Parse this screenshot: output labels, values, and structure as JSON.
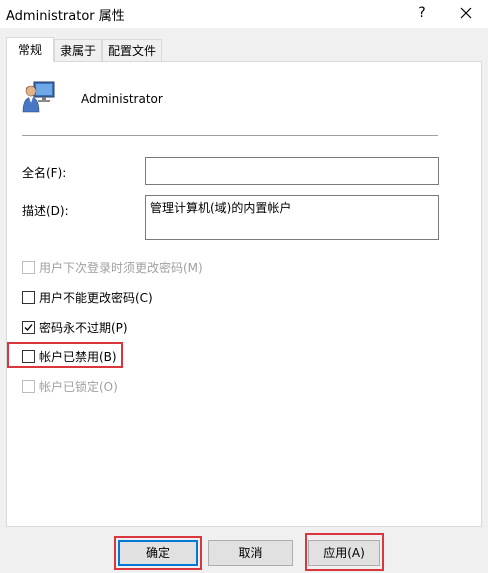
{
  "window": {
    "title": "Administrator 属性",
    "help_label": "?"
  },
  "tabs": [
    {
      "label": "常规",
      "active": true
    },
    {
      "label": "隶属于",
      "active": false
    },
    {
      "label": "配置文件",
      "active": false
    }
  ],
  "general": {
    "user_name": "Administrator",
    "full_name": {
      "label": "全名(F):",
      "value": ""
    },
    "description": {
      "label": "描述(D):",
      "value": "管理计算机(域)的内置帐户"
    },
    "options": [
      {
        "label": "用户下次登录时须更改密码(M)",
        "checked": false,
        "enabled": false
      },
      {
        "label": "用户不能更改密码(C)",
        "checked": false,
        "enabled": true
      },
      {
        "label": "密码永不过期(P)",
        "checked": true,
        "enabled": true
      },
      {
        "label": "帐户已禁用(B)",
        "checked": false,
        "enabled": true
      },
      {
        "label": "帐户已锁定(O)",
        "checked": false,
        "enabled": false
      }
    ]
  },
  "buttons": {
    "ok": "确定",
    "cancel": "取消",
    "apply": "应用(A)"
  },
  "colors": {
    "highlight": "#d9363e",
    "default_button_border": "#0078d7"
  },
  "icons": {
    "user": "user-monitor-icon",
    "close": "close-icon",
    "check": "checkmark-icon"
  }
}
